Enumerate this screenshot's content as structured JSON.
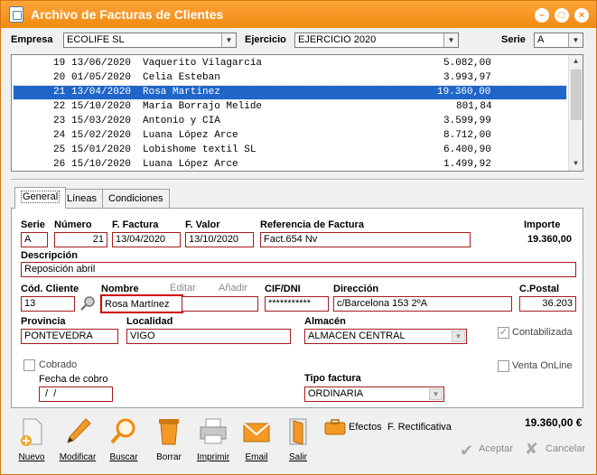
{
  "window": {
    "title": "Archivo de Facturas de Clientes",
    "min": "–",
    "max": "□",
    "close": "×"
  },
  "filters": {
    "empresa_label": "Empresa",
    "empresa_value": "ECOLIFE SL",
    "ejercicio_label": "Ejercicio",
    "ejercicio_value": "EJERCICIO 2020",
    "serie_label": "Serie",
    "serie_value": "A"
  },
  "invoices": [
    {
      "num": "19",
      "date": "13/06/2020",
      "name": "Vaquerito Vilagarcía",
      "amount": "5.082,00"
    },
    {
      "num": "20",
      "date": "01/05/2020",
      "name": "Celia Esteban",
      "amount": "3.993,97"
    },
    {
      "num": "21",
      "date": "13/04/2020",
      "name": "Rosa Martinez",
      "amount": "19.360,00"
    },
    {
      "num": "22",
      "date": "15/10/2020",
      "name": "María Borrajo Melide",
      "amount": "801,84"
    },
    {
      "num": "23",
      "date": "15/03/2020",
      "name": "Antonio y CIA",
      "amount": "3.599,99"
    },
    {
      "num": "24",
      "date": "15/02/2020",
      "name": "Luana López Arce",
      "amount": "8.712,00"
    },
    {
      "num": "25",
      "date": "15/01/2020",
      "name": "Lobishome textil SL",
      "amount": "6.400,90"
    },
    {
      "num": "26",
      "date": "15/10/2020",
      "name": "Luana López Arce",
      "amount": "1.499,92"
    }
  ],
  "tabs": [
    "General",
    "Líneas",
    "Condiciones"
  ],
  "form": {
    "serie_label": "Serie",
    "serie": "A",
    "numero_label": "Número",
    "numero": "21",
    "ffactura_label": "F. Factura",
    "ffactura": "13/04/2020",
    "fvalor_label": "F. Valor",
    "fvalor": "13/10/2020",
    "ref_label": "Referencia de Factura",
    "ref": "Fact.654 Nv",
    "importe_label": "Importe",
    "importe": "19.360,00",
    "desc_label": "Descripción",
    "desc": "Reposición abril",
    "codcliente_label": "Cód. Cliente",
    "codcliente": "13",
    "nombre_label": "Nombre",
    "nombre": "Rosa Martínez",
    "editar_label": "Editar",
    "anadir_label": "Añadir",
    "cif_label": "CIF/DNI",
    "cif": "***********",
    "direccion_label": "Dirección",
    "direccion": "c/Barcelona 153 2ºA",
    "cpostal_label": "C.Postal",
    "cpostal": "36.203",
    "provincia_label": "Provincia",
    "provincia": "PONTEVEDRA",
    "localidad_label": "Localidad",
    "localidad": "VIGO",
    "almacen_label": "Almacén",
    "almacen": "ALMACEN CENTRAL",
    "contabilizada_label": "Contabilizada",
    "cobrado_label": "Cobrado",
    "fechacobro_label": "Fecha de cobro",
    "fechacobro": " /  /",
    "tipofactura_label": "Tipo factura",
    "tipofactura": "ORDINARIA",
    "ventaonline_label": "Venta OnLine"
  },
  "toolbar": {
    "nuevo": "Nuevo",
    "modificar": "Modificar",
    "buscar": "Buscar",
    "borrar": "Borrar",
    "imprimir": "Imprimir",
    "email": "Email",
    "salir": "Salir",
    "efectos": "Efectos",
    "rectificativa": "F. Rectificativa",
    "total": "19.360,00 €",
    "aceptar": "Aceptar",
    "cancelar": "Cancelar"
  },
  "colors": {
    "title_bar": "#f08a12",
    "selection": "#1f66c8",
    "field_border": "#a81a1a"
  }
}
